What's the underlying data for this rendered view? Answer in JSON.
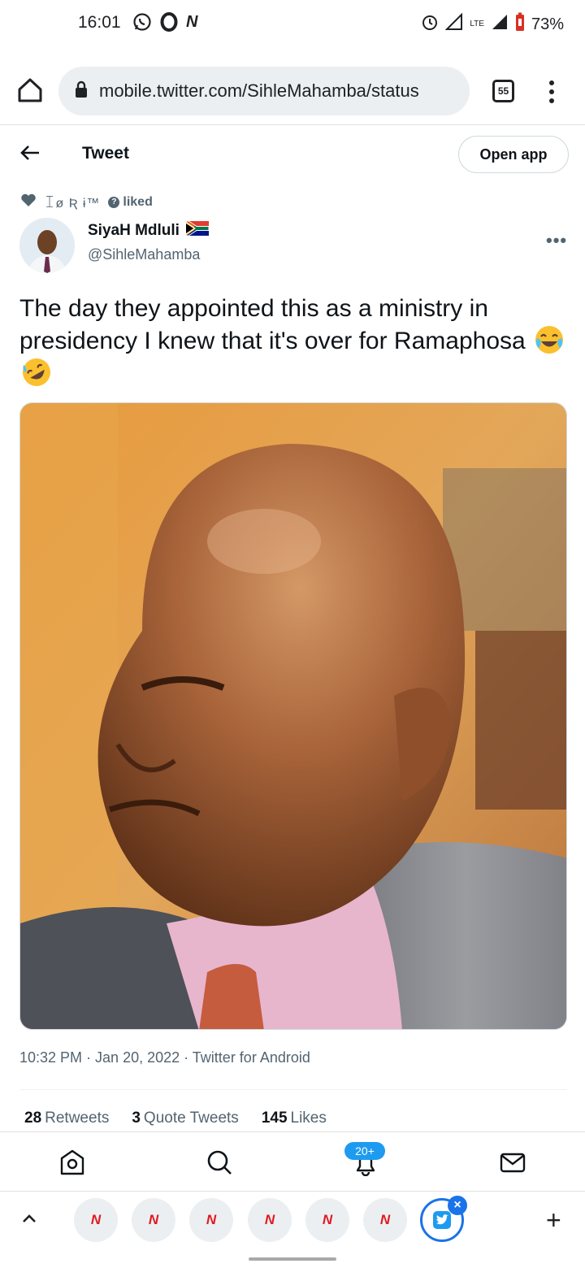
{
  "status_bar": {
    "time": "16:01",
    "battery": "73%",
    "network": "LTE",
    "icons": [
      "whatsapp-icon",
      "opera-icon",
      "news-n-icon",
      "alarm-icon",
      "signal-icon",
      "battery-icon"
    ]
  },
  "browser": {
    "url": "mobile.twitter.com/SihleMahamba/status",
    "tab_count": "55"
  },
  "header": {
    "title": "Tweet",
    "open_app": "Open app"
  },
  "social_context": {
    "liker": "ꀤø Ʀ ɨ™",
    "action": "liked"
  },
  "tweet": {
    "author_name": "SiyaH Mdluli",
    "author_handle": "@SihleMahamba",
    "text": "The day they appointed this as a ministry in presidency I knew that it's over for Ramaphosa",
    "timestamp": "10:32 PM · Jan 20, 2022 · Twitter for Android",
    "stats": {
      "retweets_count": "28",
      "retweets_label": "Retweets",
      "quotes_count": "3",
      "quotes_label": "Quote Tweets",
      "likes_count": "145",
      "likes_label": "Likes"
    }
  },
  "nav": {
    "notifications_badge": "20+"
  },
  "colors": {
    "twitter_blue": "#1d9bf0",
    "chrome_blue": "#1a73e8",
    "news_red": "#e01a22"
  }
}
